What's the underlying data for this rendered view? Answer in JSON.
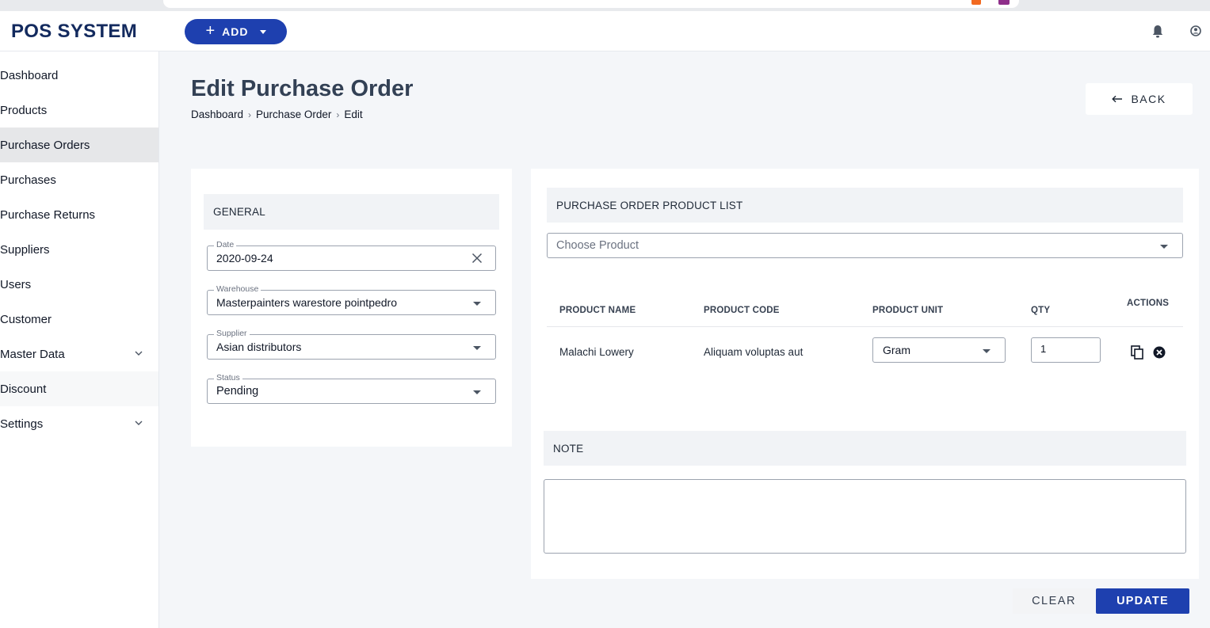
{
  "app": {
    "brand": "POS SYSTEM",
    "add_label": "ADD"
  },
  "sidebar": {
    "items": [
      {
        "label": "Dashboard"
      },
      {
        "label": "Products"
      },
      {
        "label": "Purchase Orders"
      },
      {
        "label": "Purchases"
      },
      {
        "label": "Purchase Returns"
      },
      {
        "label": "Suppliers"
      },
      {
        "label": "Users"
      },
      {
        "label": "Customer"
      },
      {
        "label": "Master Data"
      },
      {
        "label": "Discount"
      },
      {
        "label": "Settings"
      }
    ]
  },
  "page": {
    "title": "Edit Purchase Order",
    "breadcrumb": [
      "Dashboard",
      "Purchase Order",
      "Edit"
    ],
    "back_label": "BACK"
  },
  "general": {
    "heading": "GENERAL",
    "date": {
      "label": "Date",
      "value": "2020-09-24"
    },
    "warehouse": {
      "label": "Warehouse",
      "value": "Masterpainters warestore pointpedro"
    },
    "supplier": {
      "label": "Supplier",
      "value": "Asian distributors"
    },
    "status": {
      "label": "Status",
      "value": "Pending"
    }
  },
  "product_list": {
    "heading": "PURCHASE ORDER PRODUCT LIST",
    "choose_placeholder": "Choose Product",
    "columns": [
      "PRODUCT NAME",
      "PRODUCT CODE",
      "PRODUCT UNIT",
      "QTY",
      "ACTIONS"
    ],
    "rows": [
      {
        "name": "Malachi Lowery",
        "code": "Aliquam voluptas aut",
        "unit": "Gram",
        "qty": "1"
      }
    ]
  },
  "note": {
    "heading": "NOTE",
    "value": ""
  },
  "actions": {
    "clear_label": "CLEAR",
    "update_label": "UPDATE"
  },
  "colors": {
    "primary": "#1e40af",
    "brand": "#132a5e",
    "title": "#334155"
  }
}
